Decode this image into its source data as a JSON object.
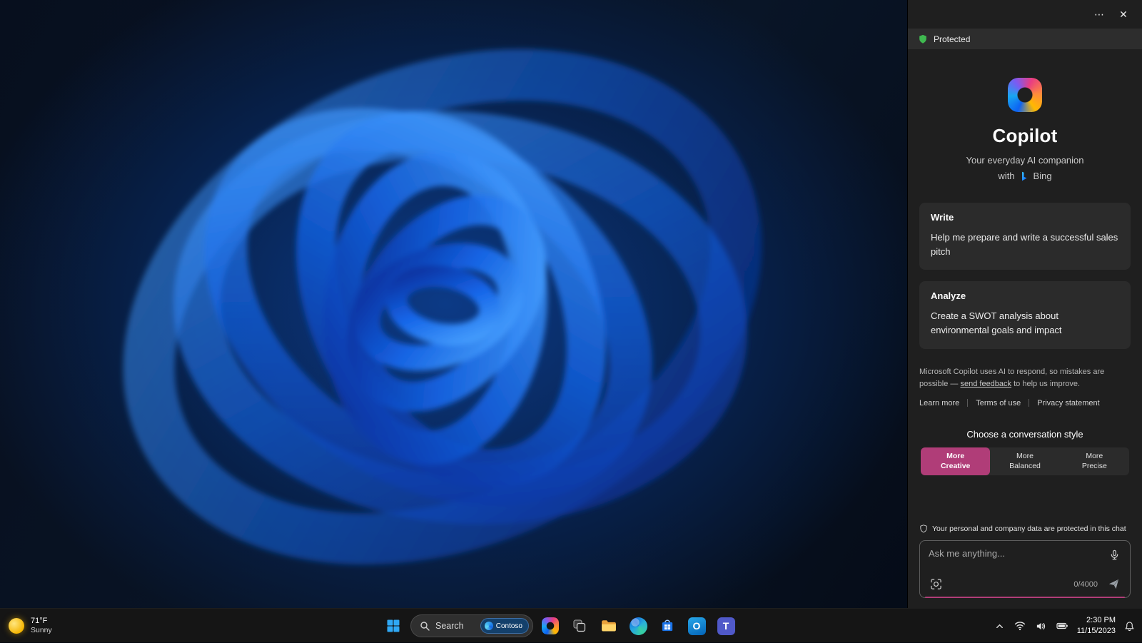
{
  "colors": {
    "accent": "#b03d78",
    "panel_bg": "#1f1f1f",
    "card_bg": "#2b2b2b",
    "protected_green": "#3fb950"
  },
  "icons": {
    "more": "⋯",
    "close": "✕"
  },
  "copilot_panel": {
    "protected_label": "Protected",
    "title": "Copilot",
    "subtitle": "Your everyday AI companion",
    "with_label": "with",
    "bing_label": "Bing",
    "cards": [
      {
        "title": "Write",
        "description": "Help me prepare and write a successful sales pitch"
      },
      {
        "title": "Analyze",
        "description": "Create a SWOT analysis about environmental goals and impact"
      }
    ],
    "disclaimer": {
      "prefix": "Microsoft Copilot uses AI to respond, so mistakes are possible — ",
      "link": "send feedback",
      "suffix": " to help us improve."
    },
    "links": [
      "Learn more",
      "Terms of use",
      "Privacy statement"
    ],
    "style_heading": "Choose a conversation style",
    "styles": [
      {
        "line1": "More",
        "line2": "Creative",
        "selected": true
      },
      {
        "line1": "More",
        "line2": "Balanced",
        "selected": false
      },
      {
        "line1": "More",
        "line2": "Precise",
        "selected": false
      }
    ],
    "privacy_note": "Your personal and company data are protected in this chat",
    "input": {
      "placeholder": "Ask me anything...",
      "counter": "0/4000"
    }
  },
  "taskbar": {
    "weather": {
      "temperature": "71°F",
      "condition": "Sunny"
    },
    "search": {
      "label": "Search",
      "badge": "Contoso"
    },
    "clock": {
      "time": "2:30 PM",
      "date": "11/15/2023"
    }
  }
}
